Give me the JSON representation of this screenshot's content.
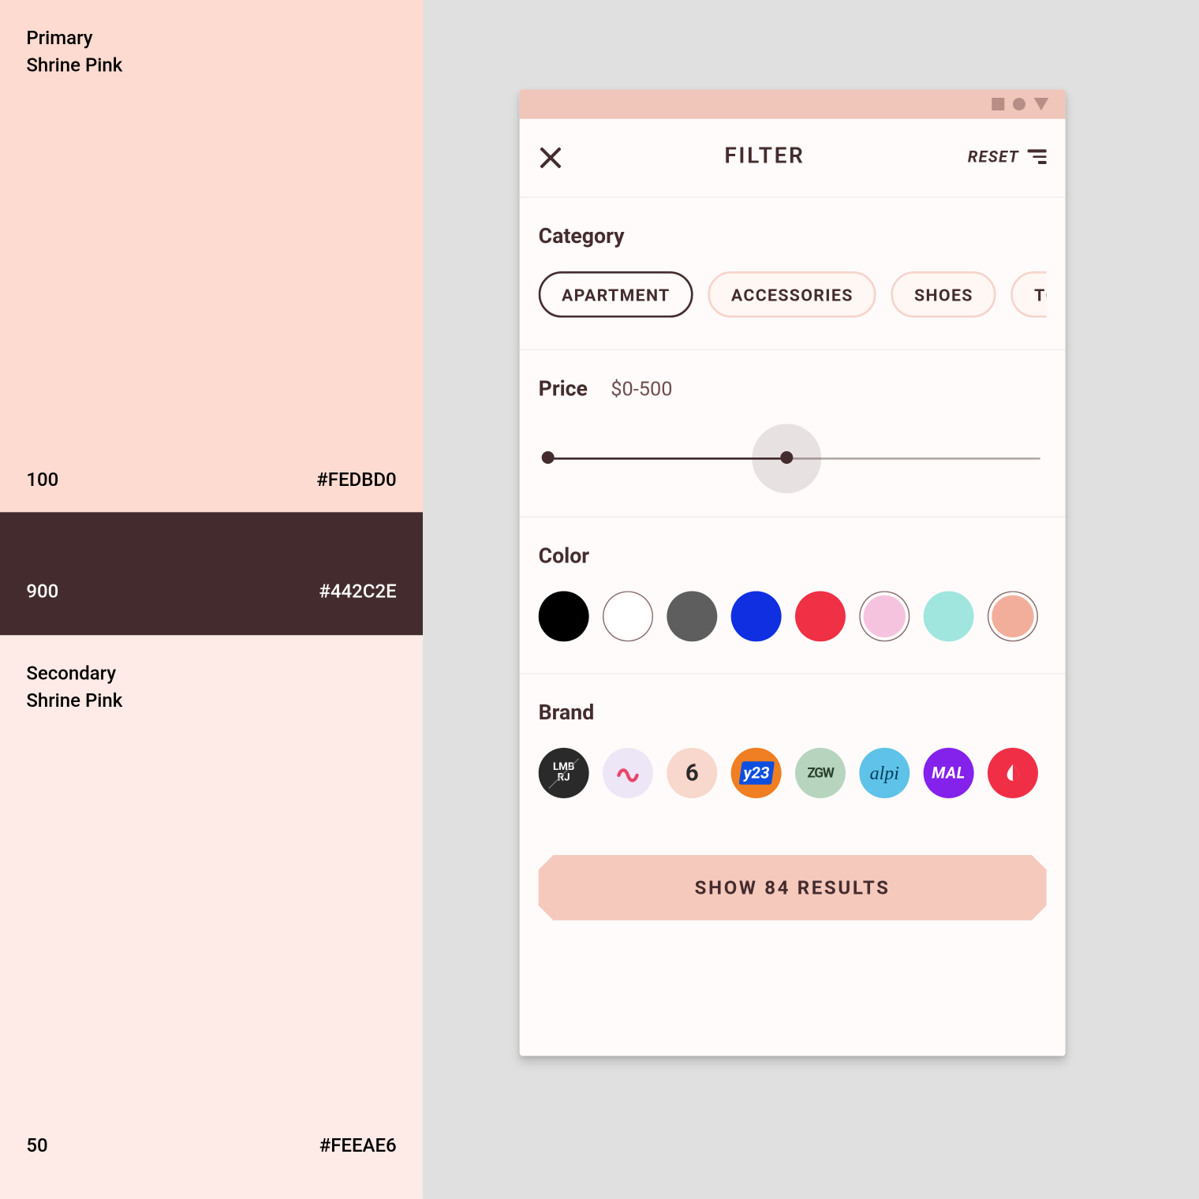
{
  "palette": {
    "primary": {
      "title": "Primary",
      "subtitle": "Shrine Pink",
      "weight": "100",
      "hex": "#FEDBD0"
    },
    "dark": {
      "weight": "900",
      "hex": "#442C2E"
    },
    "secondary": {
      "title": "Secondary",
      "subtitle": "Shrine Pink",
      "weight": "50",
      "hex": "#FEEAE6"
    }
  },
  "phone": {
    "title": "FILTER",
    "reset": "RESET",
    "category": {
      "heading": "Category",
      "chips": [
        "APARTMENT",
        "ACCESSORIES",
        "SHOES",
        "TO"
      ]
    },
    "price": {
      "heading": "Price",
      "range": "$0-500",
      "min": 0,
      "max": 500
    },
    "color": {
      "heading": "Color",
      "items": [
        {
          "name": "black",
          "hex": "#000000",
          "selected": false
        },
        {
          "name": "white",
          "hex": "#FFFFFF",
          "selected": true
        },
        {
          "name": "gray",
          "hex": "#5e5e5e",
          "selected": false
        },
        {
          "name": "blue",
          "hex": "#0f2fe0",
          "selected": false
        },
        {
          "name": "red",
          "hex": "#F03045",
          "selected": false
        },
        {
          "name": "pink",
          "hex": "#F6C3DF",
          "selected": true
        },
        {
          "name": "teal",
          "hex": "#A0E5DE",
          "selected": false
        },
        {
          "name": "peach",
          "hex": "#F2AE9B",
          "selected": true
        }
      ]
    },
    "brand": {
      "heading": "Brand",
      "items": [
        "LMB",
        "squiggle",
        "6",
        "y23",
        "ZGW",
        "alpi",
        "MAL",
        "drop"
      ]
    },
    "cta": "SHOW 84 RESULTS",
    "result_count": 84
  }
}
